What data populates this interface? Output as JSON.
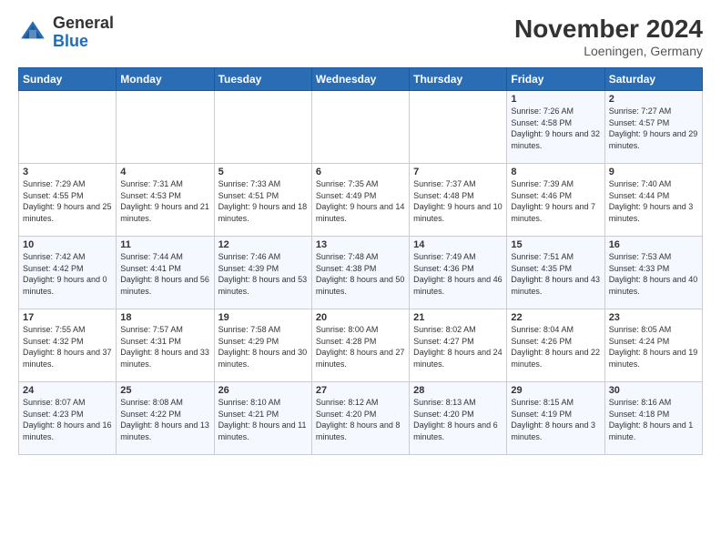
{
  "logo": {
    "text_general": "General",
    "text_blue": "Blue"
  },
  "header": {
    "month_title": "November 2024",
    "location": "Loeningen, Germany"
  },
  "weekdays": [
    "Sunday",
    "Monday",
    "Tuesday",
    "Wednesday",
    "Thursday",
    "Friday",
    "Saturday"
  ],
  "weeks": [
    [
      {
        "day": "",
        "info": ""
      },
      {
        "day": "",
        "info": ""
      },
      {
        "day": "",
        "info": ""
      },
      {
        "day": "",
        "info": ""
      },
      {
        "day": "",
        "info": ""
      },
      {
        "day": "1",
        "info": "Sunrise: 7:26 AM\nSunset: 4:58 PM\nDaylight: 9 hours and 32 minutes."
      },
      {
        "day": "2",
        "info": "Sunrise: 7:27 AM\nSunset: 4:57 PM\nDaylight: 9 hours and 29 minutes."
      }
    ],
    [
      {
        "day": "3",
        "info": "Sunrise: 7:29 AM\nSunset: 4:55 PM\nDaylight: 9 hours and 25 minutes."
      },
      {
        "day": "4",
        "info": "Sunrise: 7:31 AM\nSunset: 4:53 PM\nDaylight: 9 hours and 21 minutes."
      },
      {
        "day": "5",
        "info": "Sunrise: 7:33 AM\nSunset: 4:51 PM\nDaylight: 9 hours and 18 minutes."
      },
      {
        "day": "6",
        "info": "Sunrise: 7:35 AM\nSunset: 4:49 PM\nDaylight: 9 hours and 14 minutes."
      },
      {
        "day": "7",
        "info": "Sunrise: 7:37 AM\nSunset: 4:48 PM\nDaylight: 9 hours and 10 minutes."
      },
      {
        "day": "8",
        "info": "Sunrise: 7:39 AM\nSunset: 4:46 PM\nDaylight: 9 hours and 7 minutes."
      },
      {
        "day": "9",
        "info": "Sunrise: 7:40 AM\nSunset: 4:44 PM\nDaylight: 9 hours and 3 minutes."
      }
    ],
    [
      {
        "day": "10",
        "info": "Sunrise: 7:42 AM\nSunset: 4:42 PM\nDaylight: 9 hours and 0 minutes."
      },
      {
        "day": "11",
        "info": "Sunrise: 7:44 AM\nSunset: 4:41 PM\nDaylight: 8 hours and 56 minutes."
      },
      {
        "day": "12",
        "info": "Sunrise: 7:46 AM\nSunset: 4:39 PM\nDaylight: 8 hours and 53 minutes."
      },
      {
        "day": "13",
        "info": "Sunrise: 7:48 AM\nSunset: 4:38 PM\nDaylight: 8 hours and 50 minutes."
      },
      {
        "day": "14",
        "info": "Sunrise: 7:49 AM\nSunset: 4:36 PM\nDaylight: 8 hours and 46 minutes."
      },
      {
        "day": "15",
        "info": "Sunrise: 7:51 AM\nSunset: 4:35 PM\nDaylight: 8 hours and 43 minutes."
      },
      {
        "day": "16",
        "info": "Sunrise: 7:53 AM\nSunset: 4:33 PM\nDaylight: 8 hours and 40 minutes."
      }
    ],
    [
      {
        "day": "17",
        "info": "Sunrise: 7:55 AM\nSunset: 4:32 PM\nDaylight: 8 hours and 37 minutes."
      },
      {
        "day": "18",
        "info": "Sunrise: 7:57 AM\nSunset: 4:31 PM\nDaylight: 8 hours and 33 minutes."
      },
      {
        "day": "19",
        "info": "Sunrise: 7:58 AM\nSunset: 4:29 PM\nDaylight: 8 hours and 30 minutes."
      },
      {
        "day": "20",
        "info": "Sunrise: 8:00 AM\nSunset: 4:28 PM\nDaylight: 8 hours and 27 minutes."
      },
      {
        "day": "21",
        "info": "Sunrise: 8:02 AM\nSunset: 4:27 PM\nDaylight: 8 hours and 24 minutes."
      },
      {
        "day": "22",
        "info": "Sunrise: 8:04 AM\nSunset: 4:26 PM\nDaylight: 8 hours and 22 minutes."
      },
      {
        "day": "23",
        "info": "Sunrise: 8:05 AM\nSunset: 4:24 PM\nDaylight: 8 hours and 19 minutes."
      }
    ],
    [
      {
        "day": "24",
        "info": "Sunrise: 8:07 AM\nSunset: 4:23 PM\nDaylight: 8 hours and 16 minutes."
      },
      {
        "day": "25",
        "info": "Sunrise: 8:08 AM\nSunset: 4:22 PM\nDaylight: 8 hours and 13 minutes."
      },
      {
        "day": "26",
        "info": "Sunrise: 8:10 AM\nSunset: 4:21 PM\nDaylight: 8 hours and 11 minutes."
      },
      {
        "day": "27",
        "info": "Sunrise: 8:12 AM\nSunset: 4:20 PM\nDaylight: 8 hours and 8 minutes."
      },
      {
        "day": "28",
        "info": "Sunrise: 8:13 AM\nSunset: 4:20 PM\nDaylight: 8 hours and 6 minutes."
      },
      {
        "day": "29",
        "info": "Sunrise: 8:15 AM\nSunset: 4:19 PM\nDaylight: 8 hours and 3 minutes."
      },
      {
        "day": "30",
        "info": "Sunrise: 8:16 AM\nSunset: 4:18 PM\nDaylight: 8 hours and 1 minute."
      }
    ]
  ]
}
